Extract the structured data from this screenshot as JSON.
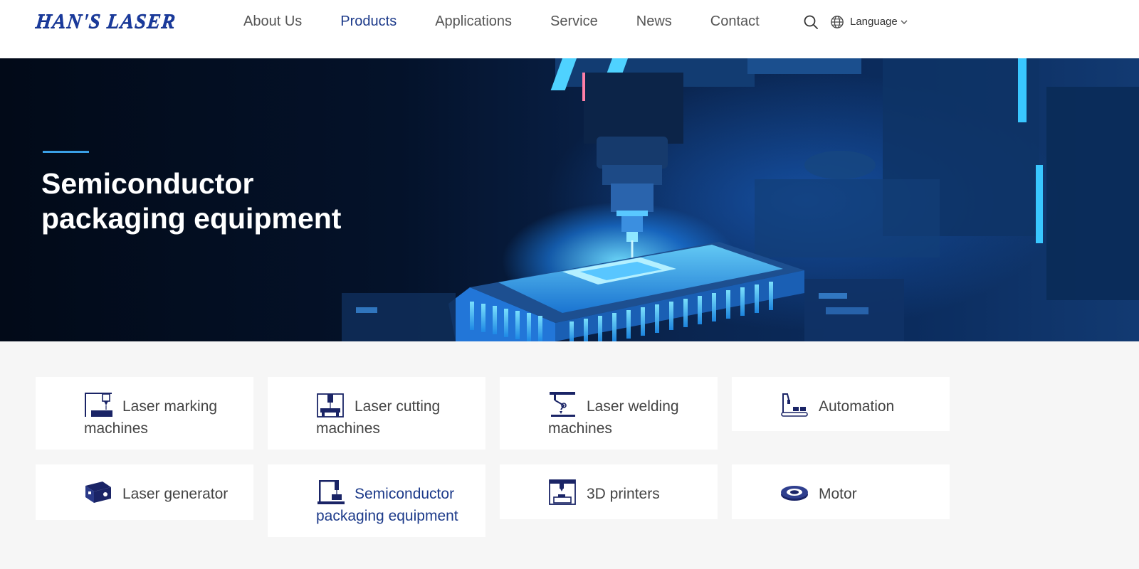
{
  "header": {
    "logo": "HAN'S LASER",
    "nav": [
      {
        "label": "About Us",
        "active": false
      },
      {
        "label": "Products",
        "active": true
      },
      {
        "label": "Applications",
        "active": false
      },
      {
        "label": "Service",
        "active": false
      },
      {
        "label": "News",
        "active": false
      },
      {
        "label": "Contact",
        "active": false
      }
    ],
    "search_icon": "search-icon",
    "language_icon": "globe-icon",
    "language_label": "Language",
    "language_chevron": "chevron-down-icon"
  },
  "hero": {
    "title_line1": "Semiconductor",
    "title_line2": "packaging equipment"
  },
  "categories": [
    {
      "label": "Laser marking machines",
      "icon": "laser-marking-icon",
      "active": false
    },
    {
      "label": "Laser cutting machines",
      "icon": "laser-cutting-icon",
      "active": false
    },
    {
      "label": "Laser welding machines",
      "icon": "laser-welding-icon",
      "active": false
    },
    {
      "label": "Automation",
      "icon": "automation-icon",
      "active": false
    },
    {
      "label": "Laser generator",
      "icon": "laser-generator-icon",
      "active": false
    },
    {
      "label": "Semiconductor packaging equipment",
      "icon": "semiconductor-packaging-icon",
      "active": true
    },
    {
      "label": "3D printers",
      "icon": "3d-printer-icon",
      "active": false
    },
    {
      "label": "Motor",
      "icon": "motor-icon",
      "active": false
    }
  ],
  "colors": {
    "brand": "#1c3a8a",
    "accent": "#3aa0e6",
    "icon": "#1a2466"
  }
}
